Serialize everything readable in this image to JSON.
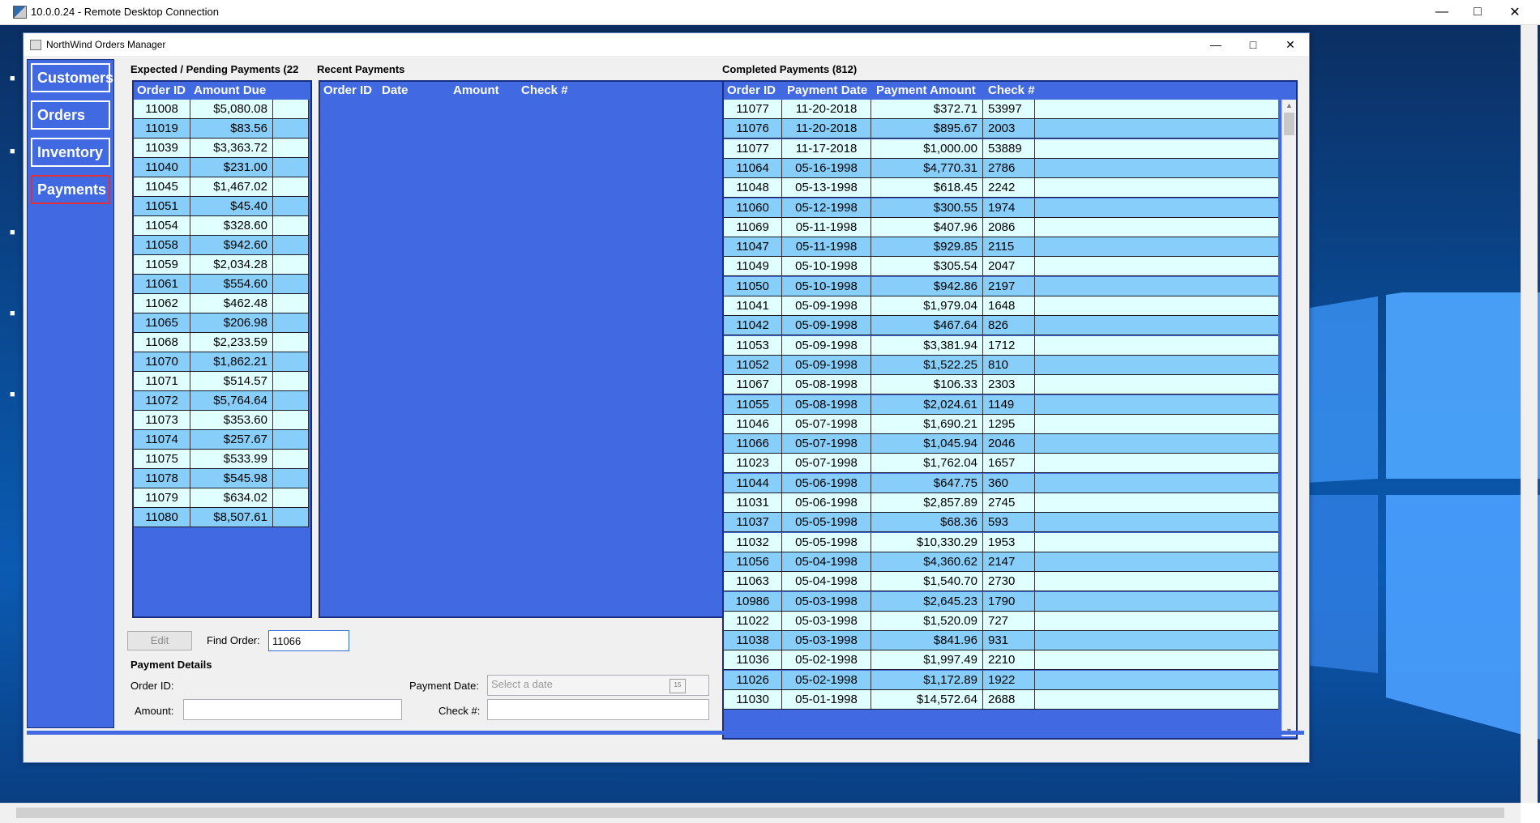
{
  "rdp": {
    "title": "10.0.0.24 - Remote Desktop Connection"
  },
  "app": {
    "title": "NorthWind Orders Manager",
    "nav": {
      "customers": "Customers",
      "orders": "Orders",
      "inventory": "Inventory",
      "payments": "Payments",
      "active": "Payments"
    }
  },
  "expected": {
    "title": "Expected / Pending Payments (22",
    "columns": [
      "Order ID",
      "Amount Due"
    ],
    "rows": [
      [
        "11008",
        "$5,080.08"
      ],
      [
        "11019",
        "$83.56"
      ],
      [
        "11039",
        "$3,363.72"
      ],
      [
        "11040",
        "$231.00"
      ],
      [
        "11045",
        "$1,467.02"
      ],
      [
        "11051",
        "$45.40"
      ],
      [
        "11054",
        "$328.60"
      ],
      [
        "11058",
        "$942.60"
      ],
      [
        "11059",
        "$2,034.28"
      ],
      [
        "11061",
        "$554.60"
      ],
      [
        "11062",
        "$462.48"
      ],
      [
        "11065",
        "$206.98"
      ],
      [
        "11068",
        "$2,233.59"
      ],
      [
        "11070",
        "$1,862.21"
      ],
      [
        "11071",
        "$514.57"
      ],
      [
        "11072",
        "$5,764.64"
      ],
      [
        "11073",
        "$353.60"
      ],
      [
        "11074",
        "$257.67"
      ],
      [
        "11075",
        "$533.99"
      ],
      [
        "11078",
        "$545.98"
      ],
      [
        "11079",
        "$634.02"
      ],
      [
        "11080",
        "$8,507.61"
      ]
    ]
  },
  "recent": {
    "title": "Recent Payments",
    "columns": [
      "Order ID",
      "Date",
      "Amount",
      "Check #"
    ]
  },
  "completed": {
    "title": "Completed Payments (812)",
    "columns": [
      "Order ID",
      "Payment Date",
      "Payment Amount",
      "Check #"
    ],
    "rows": [
      [
        "11077",
        "11-20-2018",
        "$372.71",
        "53997"
      ],
      [
        "11076",
        "11-20-2018",
        "$895.67",
        "2003"
      ],
      [
        "11077",
        "11-17-2018",
        "$1,000.00",
        "53889"
      ],
      [
        "11064",
        "05-16-1998",
        "$4,770.31",
        "2786"
      ],
      [
        "11048",
        "05-13-1998",
        "$618.45",
        "2242"
      ],
      [
        "11060",
        "05-12-1998",
        "$300.55",
        "1974"
      ],
      [
        "11069",
        "05-11-1998",
        "$407.96",
        "2086"
      ],
      [
        "11047",
        "05-11-1998",
        "$929.85",
        "2115"
      ],
      [
        "11049",
        "05-10-1998",
        "$305.54",
        "2047"
      ],
      [
        "11050",
        "05-10-1998",
        "$942.86",
        "2197"
      ],
      [
        "11041",
        "05-09-1998",
        "$1,979.04",
        "1648"
      ],
      [
        "11042",
        "05-09-1998",
        "$467.64",
        "826"
      ],
      [
        "11053",
        "05-09-1998",
        "$3,381.94",
        "1712"
      ],
      [
        "11052",
        "05-09-1998",
        "$1,522.25",
        "810"
      ],
      [
        "11067",
        "05-08-1998",
        "$106.33",
        "2303"
      ],
      [
        "11055",
        "05-08-1998",
        "$2,024.61",
        "1149"
      ],
      [
        "11046",
        "05-07-1998",
        "$1,690.21",
        "1295"
      ],
      [
        "11066",
        "05-07-1998",
        "$1,045.94",
        "2046"
      ],
      [
        "11023",
        "05-07-1998",
        "$1,762.04",
        "1657"
      ],
      [
        "11044",
        "05-06-1998",
        "$647.75",
        "360"
      ],
      [
        "11031",
        "05-06-1998",
        "$2,857.89",
        "2745"
      ],
      [
        "11037",
        "05-05-1998",
        "$68.36",
        "593"
      ],
      [
        "11032",
        "05-05-1998",
        "$10,330.29",
        "1953"
      ],
      [
        "11056",
        "05-04-1998",
        "$4,360.62",
        "2147"
      ],
      [
        "11063",
        "05-04-1998",
        "$1,540.70",
        "2730"
      ],
      [
        "10986",
        "05-03-1998",
        "$2,645.23",
        "1790"
      ],
      [
        "11022",
        "05-03-1998",
        "$1,520.09",
        "727"
      ],
      [
        "11038",
        "05-03-1998",
        "$841.96",
        "931"
      ],
      [
        "11036",
        "05-02-1998",
        "$1,997.49",
        "2210"
      ],
      [
        "11026",
        "05-02-1998",
        "$1,172.89",
        "1922"
      ],
      [
        "11030",
        "05-01-1998",
        "$14,572.64",
        "2688"
      ]
    ]
  },
  "toolbar": {
    "edit_label": "Edit",
    "find_label": "Find Order:",
    "find_value": "11066"
  },
  "details": {
    "title": "Payment Details",
    "order_id_label": "Order ID:",
    "payment_date_label": "Payment Date:",
    "date_placeholder": "Select a date",
    "amount_label": "Amount:",
    "check_label": "Check #:",
    "calendar_day": "15"
  },
  "colors": {
    "accent": "#4169E1",
    "row_light": "#E0FFFF",
    "row_dark": "#87CEFA",
    "active_border": "#E0303A"
  }
}
